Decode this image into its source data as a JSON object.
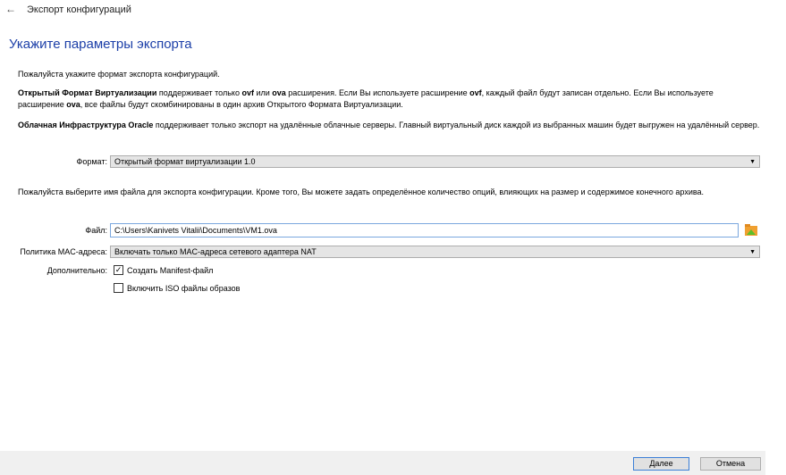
{
  "window": {
    "title": "Экспорт конфигураций",
    "back_icon": "←"
  },
  "heading": "Укажите параметры экспорта",
  "intro": "Пожалуйста укажите формат экспорта конфигураций.",
  "ovf_para": {
    "b1": "Открытый Формат Виртуализации",
    "t1": " поддерживает только ",
    "b2": "ovf",
    "t2": " или ",
    "b3": "ova",
    "t3": " расширения. Если Вы используете расширение ",
    "b4": "ovf",
    "t4": ", каждый файл будут записан отдельно. Если Вы используете расширение ",
    "b5": "ova",
    "t5": ", все файлы будут скомбинированы в один архив Открытого Формата Виртуализации."
  },
  "oci_para": {
    "b1": "Облачная Инфраструктура Oracle",
    "t1": " поддерживает только экспорт на удалённые облачные серверы. Главный виртуальный диск каждой из выбранных машин будет выгружен на удалённый сервер."
  },
  "format": {
    "label": "Формат:",
    "value": "Открытый формат виртуализации 1.0"
  },
  "file_para": "Пожалуйста выберите имя файла для экспорта конфигурации. Кроме того, Вы можете задать определённое количество опций, влияющих на размер и содержимое конечного архива.",
  "file": {
    "label": "Файл:",
    "value": "C:\\Users\\Kanivets Vitalii\\Documents\\VM1.ova"
  },
  "mac": {
    "label": "Политика MAC-адреса:",
    "value": "Включать только MAC-адреса сетевого адаптера NAT"
  },
  "additional": {
    "label": "Дополнительно:",
    "manifest": "Создать Manifest-файл",
    "manifest_checked": true,
    "iso": "Включить ISO файлы образов",
    "iso_checked": false
  },
  "buttons": {
    "next": "Далее",
    "cancel": "Отмена"
  }
}
